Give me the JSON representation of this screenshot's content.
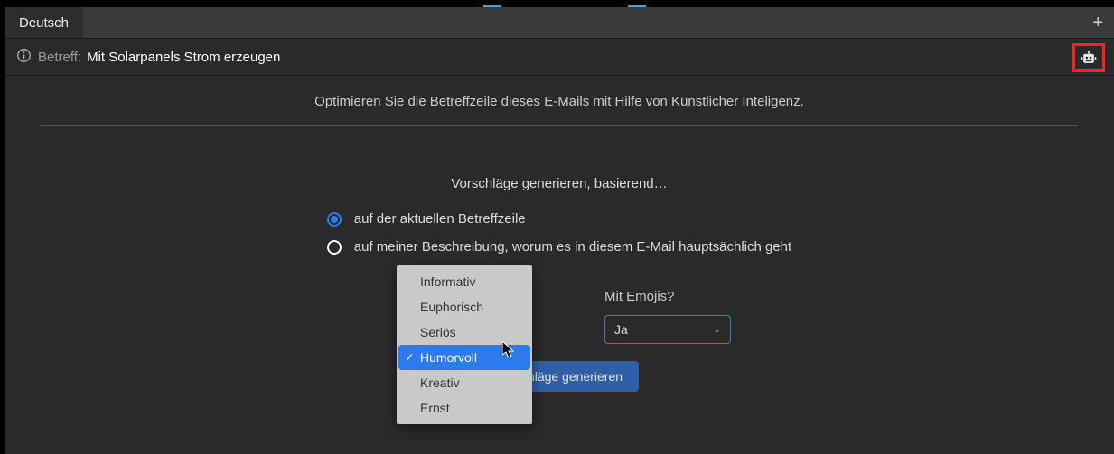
{
  "tab": {
    "language": "Deutsch"
  },
  "subject": {
    "label": "Betreff:",
    "value": "Mit Solarpanels Strom erzeugen"
  },
  "intro": "Optimieren Sie die Betreffzeile dieses E-Mails mit Hilfe von Künstlicher Inteligenz.",
  "section_title": "Vorschläge generieren, basierend…",
  "radios": {
    "opt1": "auf der aktuellen Betreffzeile",
    "opt2": "auf meiner Beschreibung, worum es in diesem E-Mail hauptsächlich geht"
  },
  "tone": {
    "options": [
      "Informativ",
      "Euphorisch",
      "Seriös",
      "Humorvoll",
      "Kreativ",
      "Ernst"
    ],
    "selected": "Humorvoll"
  },
  "emoji": {
    "label": "Mit Emojis?",
    "value": "Ja"
  },
  "generate_label": "Vorschläge generieren"
}
